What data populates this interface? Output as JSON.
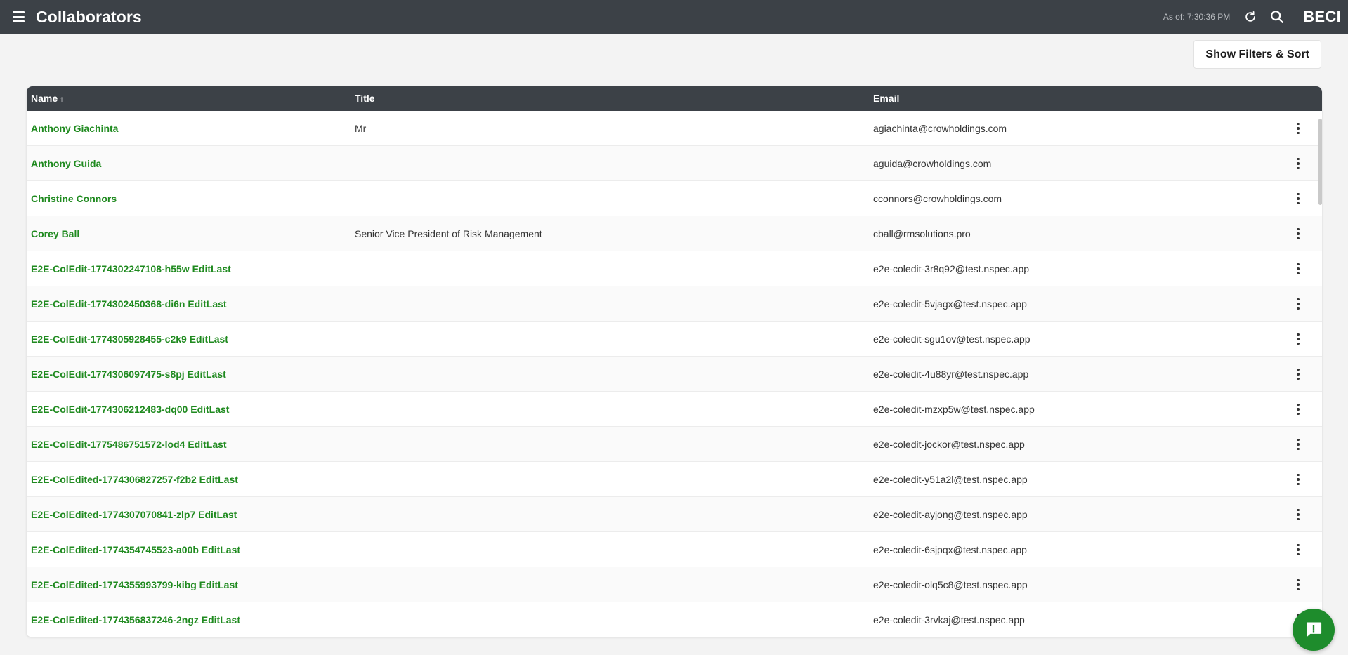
{
  "header": {
    "title": "Collaborators",
    "as_of": "As of: 7:30:36 PM",
    "brand": "BECI"
  },
  "toolbar": {
    "filters_label": "Show Filters & Sort"
  },
  "table": {
    "columns": {
      "name": "Name",
      "name_sort": "↑",
      "title": "Title",
      "email": "Email"
    },
    "rows": [
      {
        "name": "Anthony Giachinta",
        "title": "Mr",
        "email": "agiachinta@crowholdings.com"
      },
      {
        "name": "Anthony Guida",
        "title": "",
        "email": "aguida@crowholdings.com"
      },
      {
        "name": "Christine Connors",
        "title": "",
        "email": "cconnors@crowholdings.com"
      },
      {
        "name": "Corey Ball",
        "title": "Senior Vice President of Risk Management",
        "email": "cball@rmsolutions.pro"
      },
      {
        "name": "E2E-ColEdit-1774302247108-h55w EditLast",
        "title": "",
        "email": "e2e-coledit-3r8q92@test.nspec.app"
      },
      {
        "name": "E2E-ColEdit-1774302450368-di6n EditLast",
        "title": "",
        "email": "e2e-coledit-5vjagx@test.nspec.app"
      },
      {
        "name": "E2E-ColEdit-1774305928455-c2k9 EditLast",
        "title": "",
        "email": "e2e-coledit-sgu1ov@test.nspec.app"
      },
      {
        "name": "E2E-ColEdit-1774306097475-s8pj EditLast",
        "title": "",
        "email": "e2e-coledit-4u88yr@test.nspec.app"
      },
      {
        "name": "E2E-ColEdit-1774306212483-dq00 EditLast",
        "title": "",
        "email": "e2e-coledit-mzxp5w@test.nspec.app"
      },
      {
        "name": "E2E-ColEdit-1775486751572-lod4 EditLast",
        "title": "",
        "email": "e2e-coledit-jockor@test.nspec.app"
      },
      {
        "name": "E2E-ColEdited-1774306827257-f2b2 EditLast",
        "title": "",
        "email": "e2e-coledit-y51a2l@test.nspec.app"
      },
      {
        "name": "E2E-ColEdited-1774307070841-zlp7 EditLast",
        "title": "",
        "email": "e2e-coledit-ayjong@test.nspec.app"
      },
      {
        "name": "E2E-ColEdited-1774354745523-a00b EditLast",
        "title": "",
        "email": "e2e-coledit-6sjpqx@test.nspec.app"
      },
      {
        "name": "E2E-ColEdited-1774355993799-kibg EditLast",
        "title": "",
        "email": "e2e-coledit-olq5c8@test.nspec.app"
      },
      {
        "name": "E2E-ColEdited-1774356837246-2ngz EditLast",
        "title": "",
        "email": "e2e-coledit-3rvkaj@test.nspec.app"
      }
    ]
  },
  "icons": {
    "menu": "hamburger-menu-icon",
    "refresh": "refresh-icon",
    "search": "search-icon",
    "row_menu": "more-vertical-icon",
    "chat": "chat-feedback-icon"
  },
  "colors": {
    "topbar": "#3c4147",
    "link_green": "#1f8a1f",
    "fab_green": "#1e8c2c",
    "background": "#f3f3f3"
  }
}
